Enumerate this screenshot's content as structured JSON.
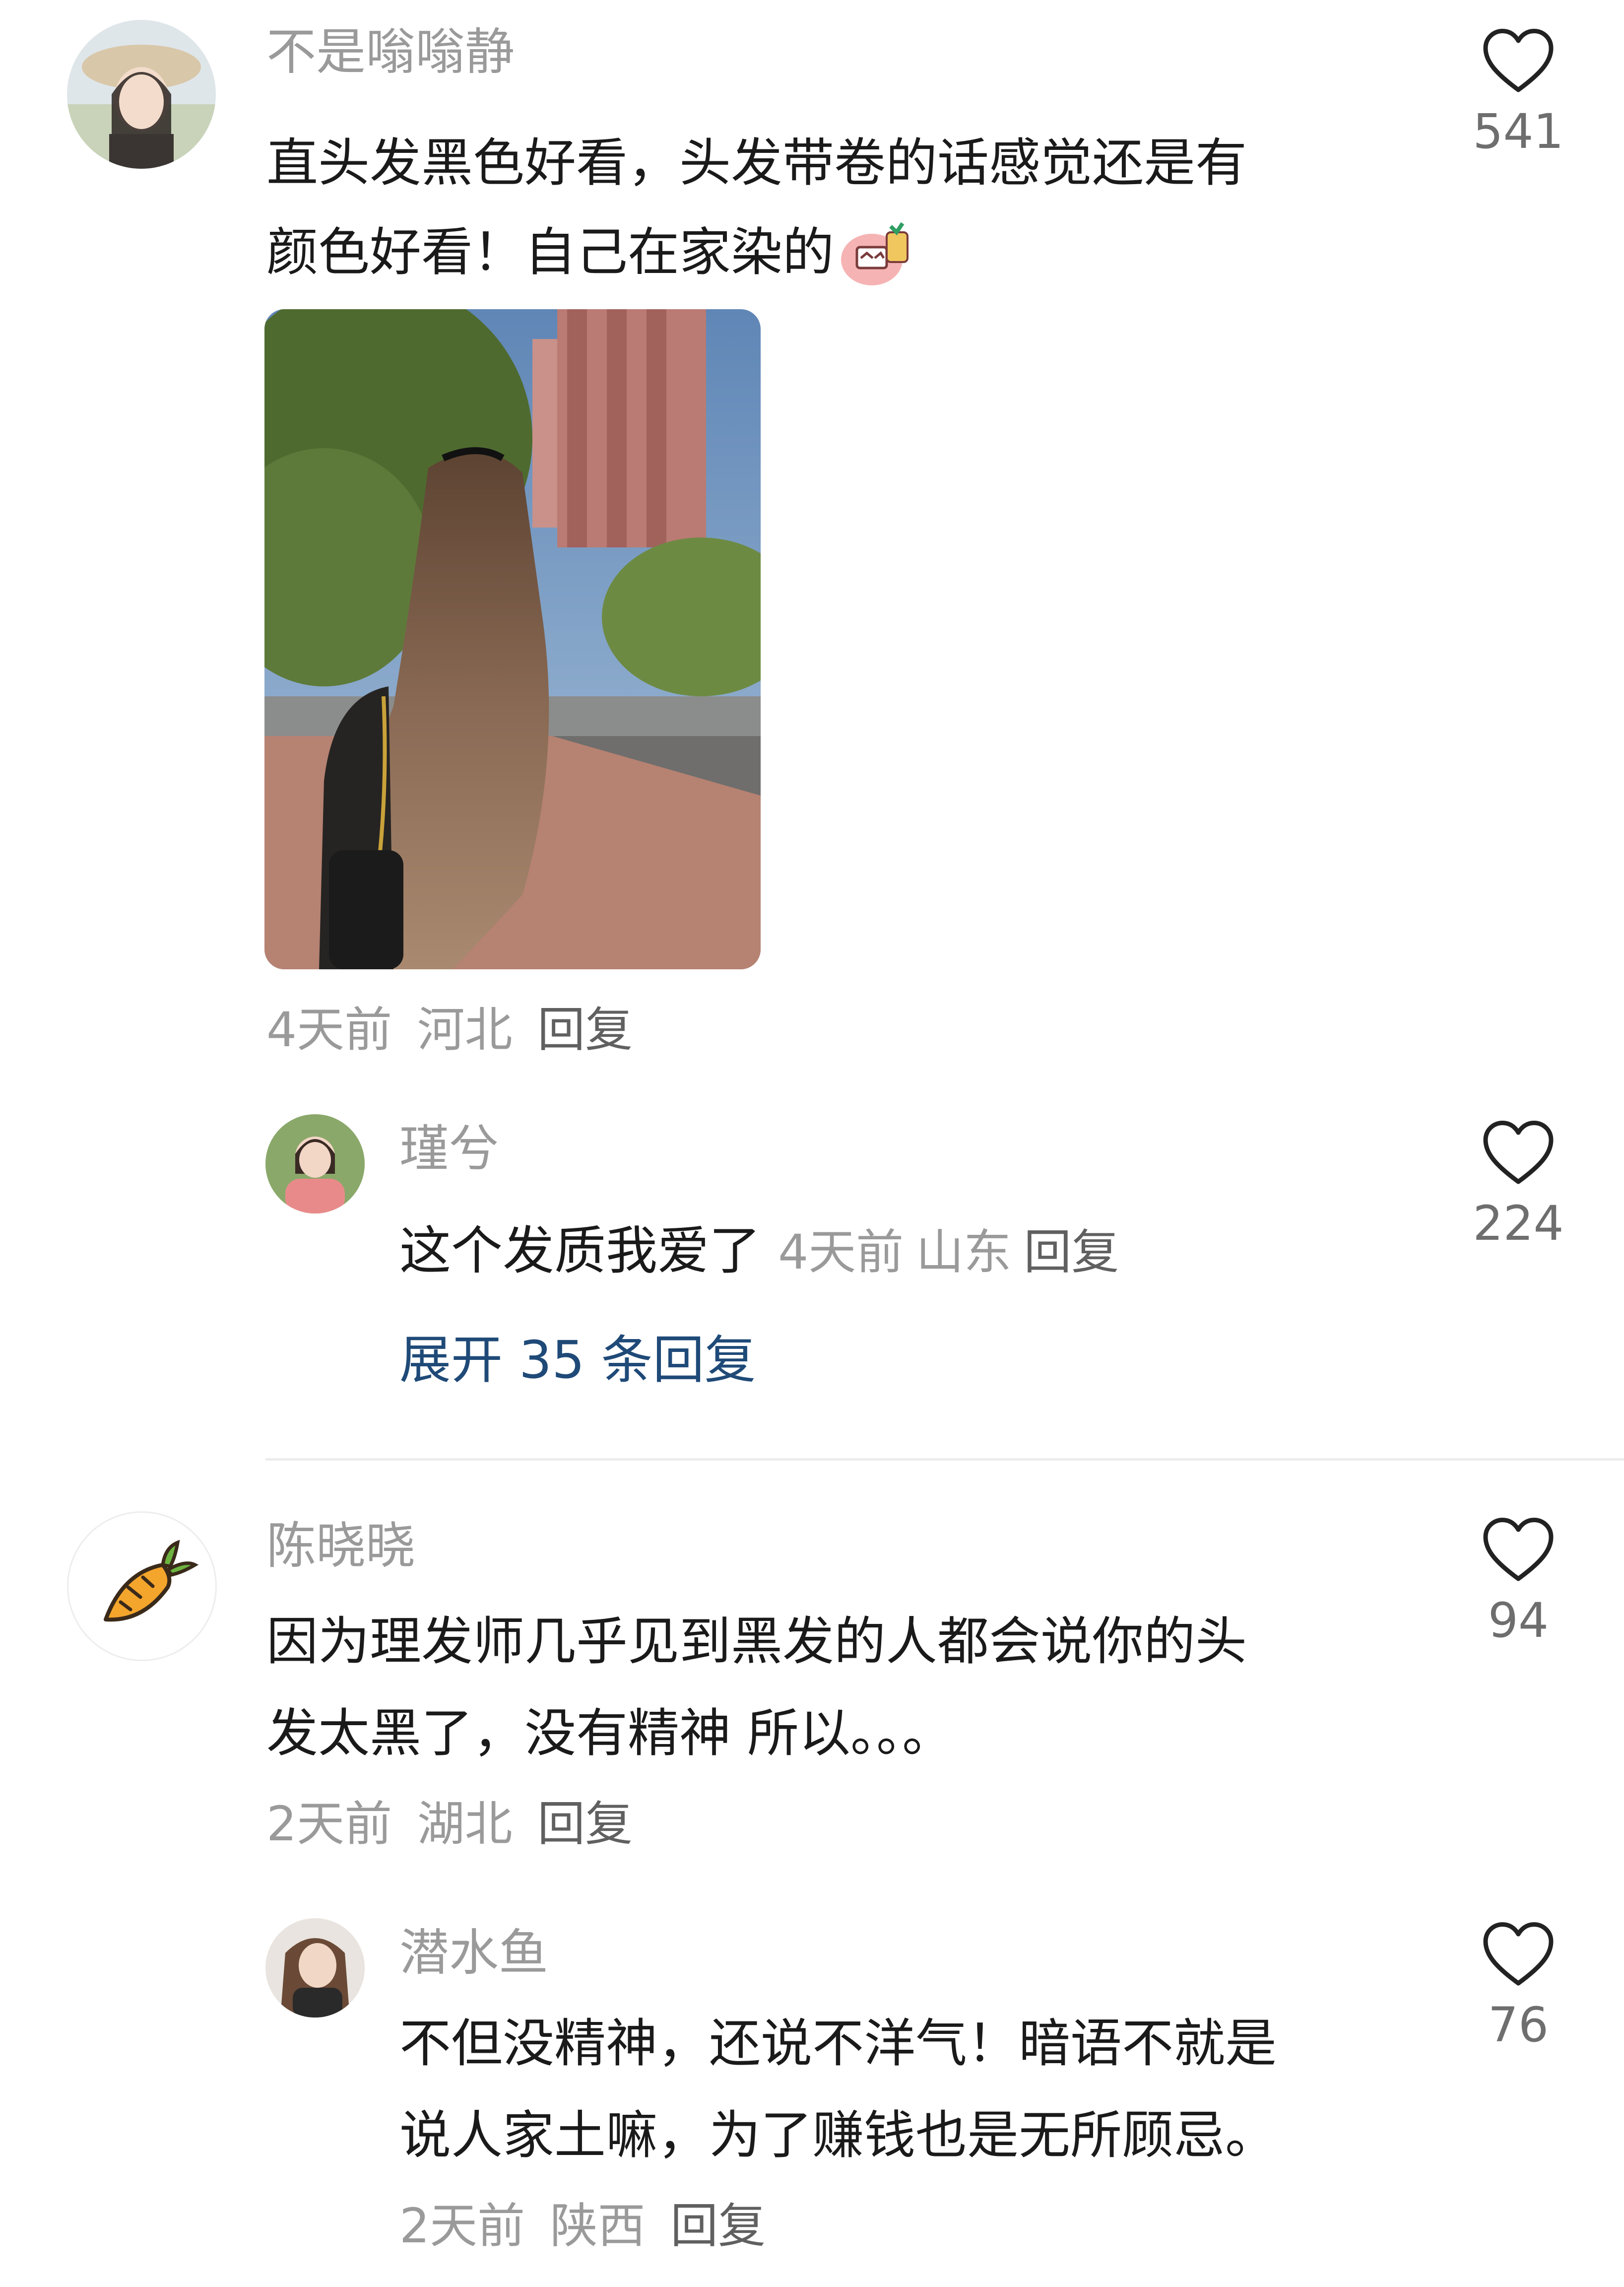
{
  "comments": [
    {
      "username": "不是嗡嗡静",
      "text_line1": "直头发黑色好看，头发带卷的话感觉还是有",
      "text_line2": "颜色好看！自己在家染的",
      "emoji": "sticker-emoji",
      "time": "4天前",
      "location": "河北",
      "reply_label": "回复",
      "likes": "541",
      "replies": [
        {
          "username": "瑾兮",
          "text": "这个发质我爱了",
          "time": "4天前",
          "location": "山东",
          "reply_label": "回复",
          "likes": "224"
        }
      ],
      "expand_label": "展开 35 条回复"
    },
    {
      "username": "陈晓晓",
      "avatar_icon": "carrot-icon",
      "text_line1": "因为理发师几乎见到黑发的人都会说你的头",
      "text_line2": "发太黑了，没有精神 所以。。。",
      "time": "2天前",
      "location": "湖北",
      "reply_label": "回复",
      "likes": "94",
      "replies": [
        {
          "username": "潜水鱼",
          "text_line1": "不但没精神，还说不洋气！暗语不就是",
          "text_line2": "说人家土嘛，为了赚钱也是无所顾忌。",
          "time": "2天前",
          "location": "陕西",
          "reply_label": "回复",
          "likes": "76"
        }
      ]
    }
  ],
  "colors": {
    "name": "#9a9a9a",
    "body": "#1a1a1a",
    "meta": "#9a9a9a",
    "link": "#1f4a78",
    "divider": "#ececec"
  }
}
